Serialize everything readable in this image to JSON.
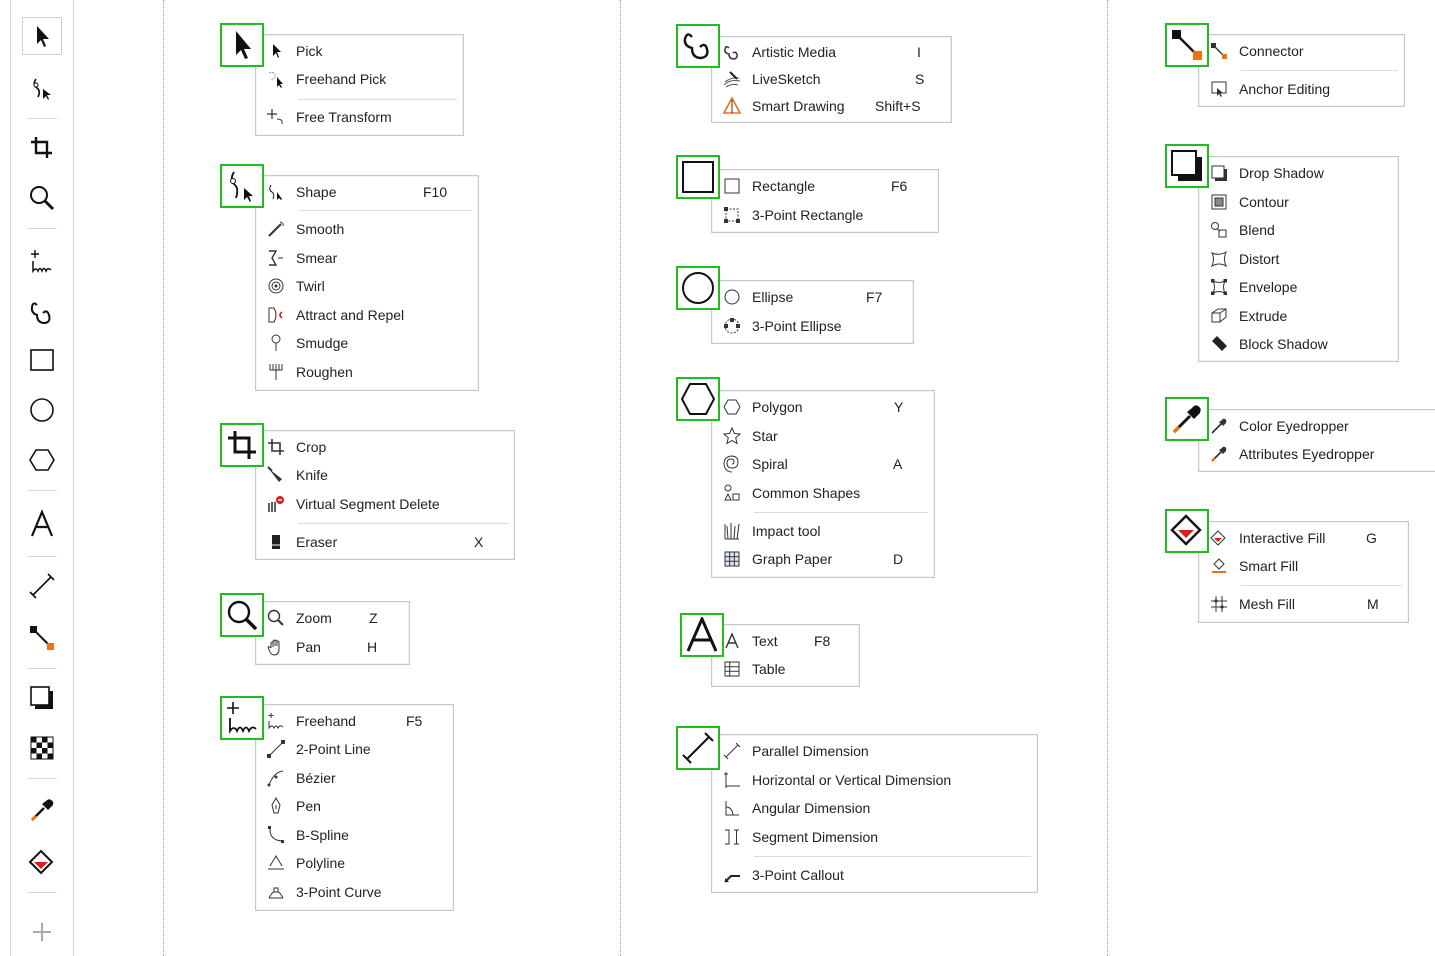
{
  "toolbar": {
    "tools": [
      {
        "icon": "pick-arrow-icon"
      },
      {
        "icon": "shape-tool-icon"
      },
      {
        "icon": "crop-tool-icon"
      },
      {
        "icon": "zoom-tool-icon"
      },
      {
        "icon": "freehand-tool-icon"
      },
      {
        "icon": "artistic-media-icon"
      },
      {
        "icon": "rectangle-tool-icon"
      },
      {
        "icon": "ellipse-tool-icon"
      },
      {
        "icon": "polygon-tool-icon"
      },
      {
        "icon": "text-tool-icon"
      },
      {
        "icon": "dimension-tool-icon"
      },
      {
        "icon": "connector-tool-icon"
      },
      {
        "icon": "drop-shadow-icon"
      },
      {
        "icon": "transparency-icon"
      },
      {
        "icon": "eyedropper-icon"
      },
      {
        "icon": "interactive-fill-icon"
      },
      {
        "icon": "add-tool-icon"
      }
    ]
  },
  "flyouts": {
    "pick": {
      "items": [
        {
          "label": "Pick",
          "key": ""
        },
        {
          "label": "Freehand Pick",
          "key": ""
        },
        {
          "label": "Free Transform",
          "key": ""
        }
      ]
    },
    "shape": {
      "items": [
        {
          "label": "Shape",
          "key": "F10"
        },
        {
          "label": "Smooth",
          "key": ""
        },
        {
          "label": "Smear",
          "key": ""
        },
        {
          "label": "Twirl",
          "key": ""
        },
        {
          "label": "Attract and Repel",
          "key": ""
        },
        {
          "label": "Smudge",
          "key": ""
        },
        {
          "label": "Roughen",
          "key": ""
        }
      ]
    },
    "crop": {
      "items": [
        {
          "label": "Crop",
          "key": ""
        },
        {
          "label": "Knife",
          "key": ""
        },
        {
          "label": "Virtual Segment Delete",
          "key": ""
        },
        {
          "label": "Eraser",
          "key": "X"
        }
      ]
    },
    "zoom": {
      "items": [
        {
          "label": "Zoom",
          "key": "Z"
        },
        {
          "label": "Pan",
          "key": "H"
        }
      ]
    },
    "curve": {
      "items": [
        {
          "label": "Freehand",
          "key": "F5"
        },
        {
          "label": "2-Point Line",
          "key": ""
        },
        {
          "label": "Bézier",
          "key": ""
        },
        {
          "label": "Pen",
          "key": ""
        },
        {
          "label": "B-Spline",
          "key": ""
        },
        {
          "label": "Polyline",
          "key": ""
        },
        {
          "label": "3-Point Curve",
          "key": ""
        }
      ]
    },
    "artistic": {
      "items": [
        {
          "label": "Artistic Media",
          "key": "I"
        },
        {
          "label": "LiveSketch",
          "key": "S"
        },
        {
          "label": "Smart Drawing",
          "key": "Shift+S"
        }
      ]
    },
    "rectangle": {
      "items": [
        {
          "label": "Rectangle",
          "key": "F6"
        },
        {
          "label": "3-Point Rectangle",
          "key": ""
        }
      ]
    },
    "ellipse": {
      "items": [
        {
          "label": "Ellipse",
          "key": "F7"
        },
        {
          "label": "3-Point Ellipse",
          "key": ""
        }
      ]
    },
    "polygon": {
      "items": [
        {
          "label": "Polygon",
          "key": "Y"
        },
        {
          "label": "Star",
          "key": ""
        },
        {
          "label": "Spiral",
          "key": "A"
        },
        {
          "label": "Common Shapes",
          "key": ""
        },
        {
          "label": "Impact tool",
          "key": ""
        },
        {
          "label": "Graph Paper",
          "key": "D"
        }
      ]
    },
    "text": {
      "items": [
        {
          "label": "Text",
          "key": "F8"
        },
        {
          "label": "Table",
          "key": ""
        }
      ]
    },
    "dimension": {
      "items": [
        {
          "label": "Parallel Dimension",
          "key": ""
        },
        {
          "label": "Horizontal or Vertical Dimension",
          "key": ""
        },
        {
          "label": "Angular Dimension",
          "key": ""
        },
        {
          "label": "Segment Dimension",
          "key": ""
        },
        {
          "label": "3-Point Callout",
          "key": ""
        }
      ]
    },
    "connector": {
      "items": [
        {
          "label": "Connector",
          "key": ""
        },
        {
          "label": "Anchor Editing",
          "key": ""
        }
      ]
    },
    "effects": {
      "items": [
        {
          "label": "Drop Shadow",
          "key": ""
        },
        {
          "label": "Contour",
          "key": ""
        },
        {
          "label": "Blend",
          "key": ""
        },
        {
          "label": "Distort",
          "key": ""
        },
        {
          "label": "Envelope",
          "key": ""
        },
        {
          "label": "Extrude",
          "key": ""
        },
        {
          "label": "Block Shadow",
          "key": ""
        }
      ]
    },
    "eyedropper": {
      "items": [
        {
          "label": "Color Eyedropper",
          "key": ""
        },
        {
          "label": "Attributes Eyedropper",
          "key": ""
        }
      ]
    },
    "fill": {
      "items": [
        {
          "label": "Interactive Fill",
          "key": "G"
        },
        {
          "label": "Smart Fill",
          "key": ""
        },
        {
          "label": "Mesh Fill",
          "key": "M"
        }
      ]
    }
  },
  "colors": {
    "highlight": "#1fbd1f",
    "accent_orange": "#e8731a",
    "accent_red": "#e01b1b"
  }
}
